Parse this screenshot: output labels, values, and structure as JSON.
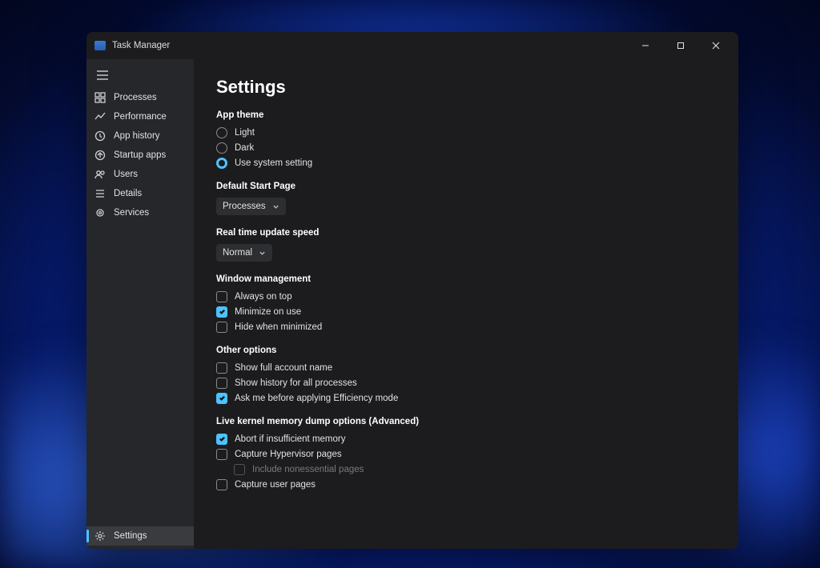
{
  "app": {
    "title": "Task Manager"
  },
  "sidebar": {
    "items": [
      {
        "label": "Processes"
      },
      {
        "label": "Performance"
      },
      {
        "label": "App history"
      },
      {
        "label": "Startup apps"
      },
      {
        "label": "Users"
      },
      {
        "label": "Details"
      },
      {
        "label": "Services"
      }
    ],
    "footer": {
      "label": "Settings"
    }
  },
  "page": {
    "title": "Settings",
    "sections": {
      "app_theme": {
        "label": "App theme",
        "options": [
          {
            "label": "Light",
            "selected": false
          },
          {
            "label": "Dark",
            "selected": false
          },
          {
            "label": "Use system setting",
            "selected": true
          }
        ]
      },
      "default_start_page": {
        "label": "Default Start Page",
        "value": "Processes"
      },
      "realtime_speed": {
        "label": "Real time update speed",
        "value": "Normal"
      },
      "window_mgmt": {
        "label": "Window management",
        "options": [
          {
            "label": "Always on top",
            "checked": false
          },
          {
            "label": "Minimize on use",
            "checked": true
          },
          {
            "label": "Hide when minimized",
            "checked": false
          }
        ]
      },
      "other": {
        "label": "Other options",
        "options": [
          {
            "label": "Show full account name",
            "checked": false
          },
          {
            "label": "Show history for all processes",
            "checked": false
          },
          {
            "label": "Ask me before applying Efficiency mode",
            "checked": true
          }
        ]
      },
      "kernel_dump": {
        "label": "Live kernel memory dump options (Advanced)",
        "options": [
          {
            "label": "Abort if insufficient memory",
            "checked": true
          },
          {
            "label": "Capture Hypervisor pages",
            "checked": false
          },
          {
            "label": "Include nonessential pages",
            "checked": false,
            "indented": true
          },
          {
            "label": "Capture user pages",
            "checked": false
          }
        ]
      }
    }
  }
}
